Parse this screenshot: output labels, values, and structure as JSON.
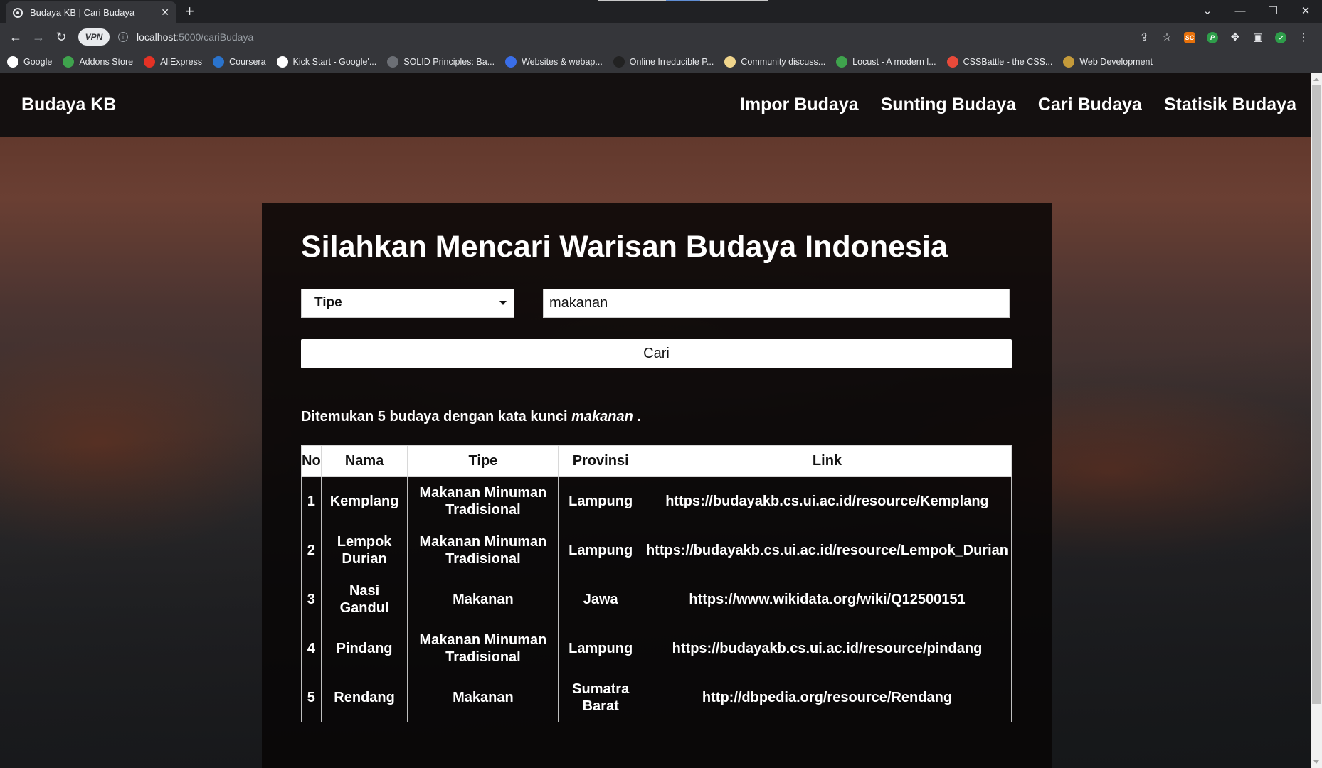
{
  "browser": {
    "tab_title": "Budaya KB | Cari Budaya",
    "url_host": "localhost",
    "url_path": ":5000/cariBudaya",
    "vpn_label": "VPN",
    "bookmarks": [
      {
        "label": "Google",
        "color": "#ffffff"
      },
      {
        "label": "Addons Store",
        "color": "#3fa34d"
      },
      {
        "label": "AliExpress",
        "color": "#e43225"
      },
      {
        "label": "Coursera",
        "color": "#2a73cc"
      },
      {
        "label": "Kick Start - Google'...",
        "color": "#ffffff"
      },
      {
        "label": "SOLID Principles: Ba...",
        "color": "#6c6f75"
      },
      {
        "label": "Websites & webap...",
        "color": "#3a6ee8"
      },
      {
        "label": "Online Irreducible P...",
        "color": "#222222"
      },
      {
        "label": "Community discuss...",
        "color": "#f0d58c"
      },
      {
        "label": "Locust - A modern l...",
        "color": "#3fa34d"
      },
      {
        "label": "CSSBattle - the CSS...",
        "color": "#e84a3a"
      },
      {
        "label": "Web Development",
        "color": "#c49a3a"
      }
    ]
  },
  "nav": {
    "brand": "Budaya KB",
    "links": [
      "Impor Budaya",
      "Sunting Budaya",
      "Cari Budaya",
      "Statisik Budaya"
    ]
  },
  "search": {
    "heading": "Silahkan Mencari Warisan Budaya Indonesia",
    "select_value": "Tipe",
    "input_value": "makanan",
    "button_label": "Cari",
    "result_prefix": "Ditemukan 5 budaya dengan kata kunci",
    "result_keyword": "makanan",
    "result_suffix": "."
  },
  "table": {
    "headers": [
      "No",
      "Nama",
      "Tipe",
      "Provinsi",
      "Link"
    ],
    "rows": [
      {
        "no": "1",
        "nama": "Kemplang",
        "tipe": "Makanan Minuman Tradisional",
        "provinsi": "Lampung",
        "link": "https://budayakb.cs.ui.ac.id/resource/Kemplang"
      },
      {
        "no": "2",
        "nama": "Lempok Durian",
        "tipe": "Makanan Minuman Tradisional",
        "provinsi": "Lampung",
        "link": "https://budayakb.cs.ui.ac.id/resource/Lempok_Durian"
      },
      {
        "no": "3",
        "nama": "Nasi Gandul",
        "tipe": "Makanan",
        "provinsi": "Jawa",
        "link": "https://www.wikidata.org/wiki/Q12500151"
      },
      {
        "no": "4",
        "nama": "Pindang",
        "tipe": "Makanan Minuman Tradisional",
        "provinsi": "Lampung",
        "link": "https://budayakb.cs.ui.ac.id/resource/pindang"
      },
      {
        "no": "5",
        "nama": "Rendang",
        "tipe": "Makanan",
        "provinsi": "Sumatra Barat",
        "link": "http://dbpedia.org/resource/Rendang"
      }
    ]
  }
}
